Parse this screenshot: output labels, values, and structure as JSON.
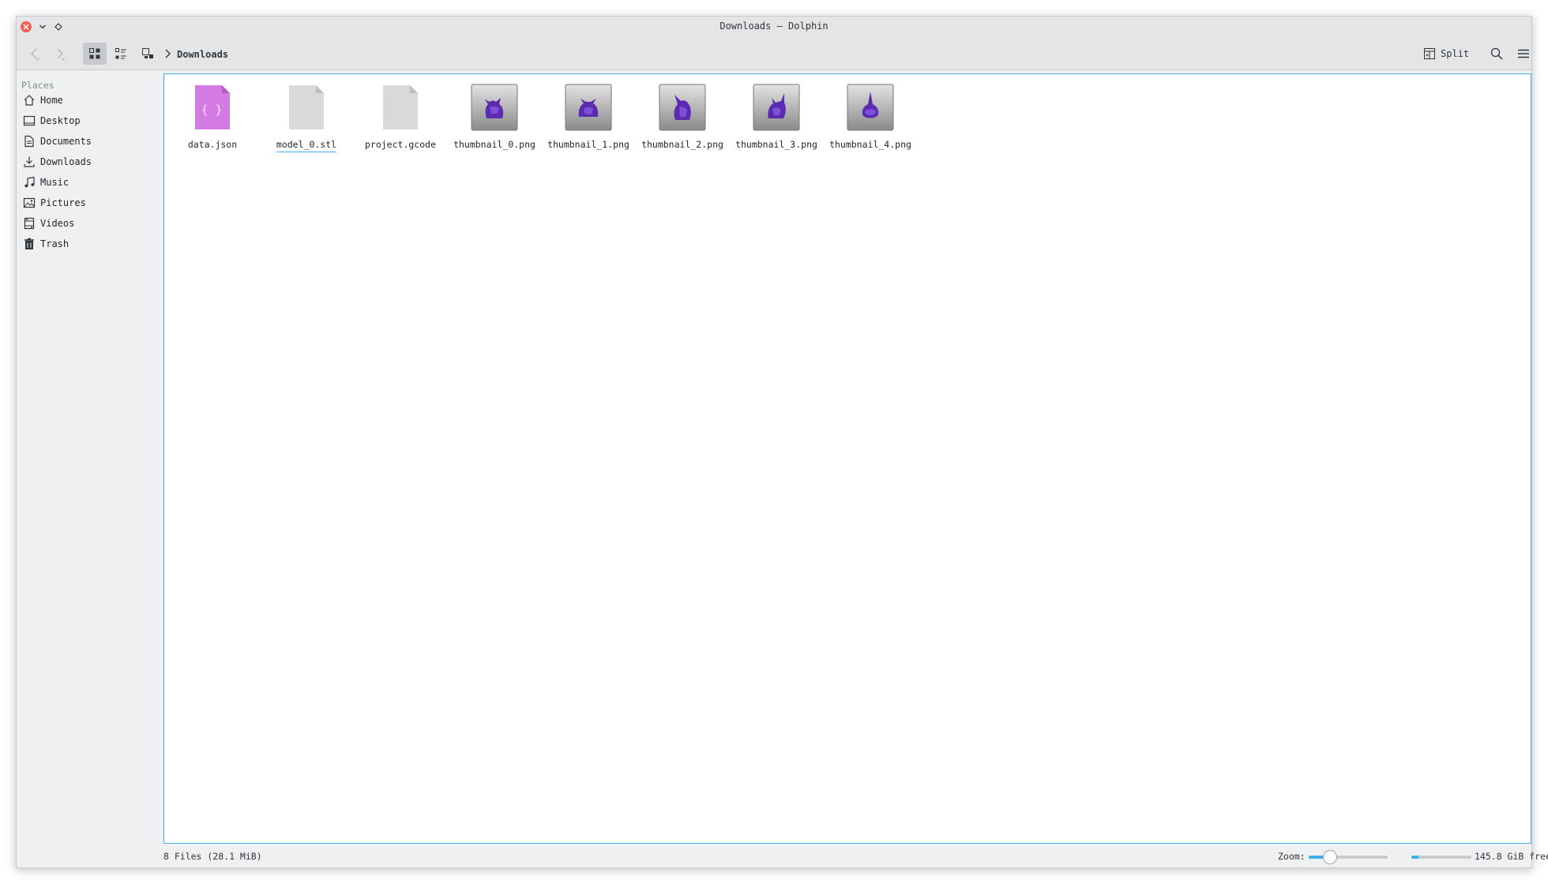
{
  "window": {
    "title": "Downloads — Dolphin"
  },
  "toolbar": {
    "breadcrumb": "Downloads",
    "split_label": "Split",
    "view_modes": [
      "icons-view",
      "details-view",
      "compact-view"
    ],
    "active_view_mode": "icons-view"
  },
  "sidebar": {
    "heading": "Places",
    "items": [
      {
        "label": "Home",
        "icon": "home-icon"
      },
      {
        "label": "Desktop",
        "icon": "desktop-icon"
      },
      {
        "label": "Documents",
        "icon": "documents-icon"
      },
      {
        "label": "Downloads",
        "icon": "downloads-icon"
      },
      {
        "label": "Music",
        "icon": "music-icon"
      },
      {
        "label": "Pictures",
        "icon": "pictures-icon"
      },
      {
        "label": "Videos",
        "icon": "videos-icon"
      },
      {
        "label": "Trash",
        "icon": "trash-icon"
      }
    ]
  },
  "files": [
    {
      "name": "data.json",
      "type": "json"
    },
    {
      "name": "model_0.stl",
      "type": "generic",
      "focused": true
    },
    {
      "name": "project.gcode",
      "type": "generic"
    },
    {
      "name": "thumbnail_0.png",
      "type": "image"
    },
    {
      "name": "thumbnail_1.png",
      "type": "image"
    },
    {
      "name": "thumbnail_2.png",
      "type": "image"
    },
    {
      "name": "thumbnail_3.png",
      "type": "image"
    },
    {
      "name": "thumbnail_4.png",
      "type": "image"
    }
  ],
  "statusbar": {
    "summary": "8 Files (28.1 MiB)",
    "zoom_label": "Zoom:",
    "zoom_level": 0.22,
    "free_space": "145.8 GiB free",
    "disk_used_fraction": 0.12
  },
  "colors": {
    "accent": "#3daee9",
    "close": "#ed5f58",
    "model_purple": "#6a2fc0",
    "json_pink": "#d37be3"
  }
}
